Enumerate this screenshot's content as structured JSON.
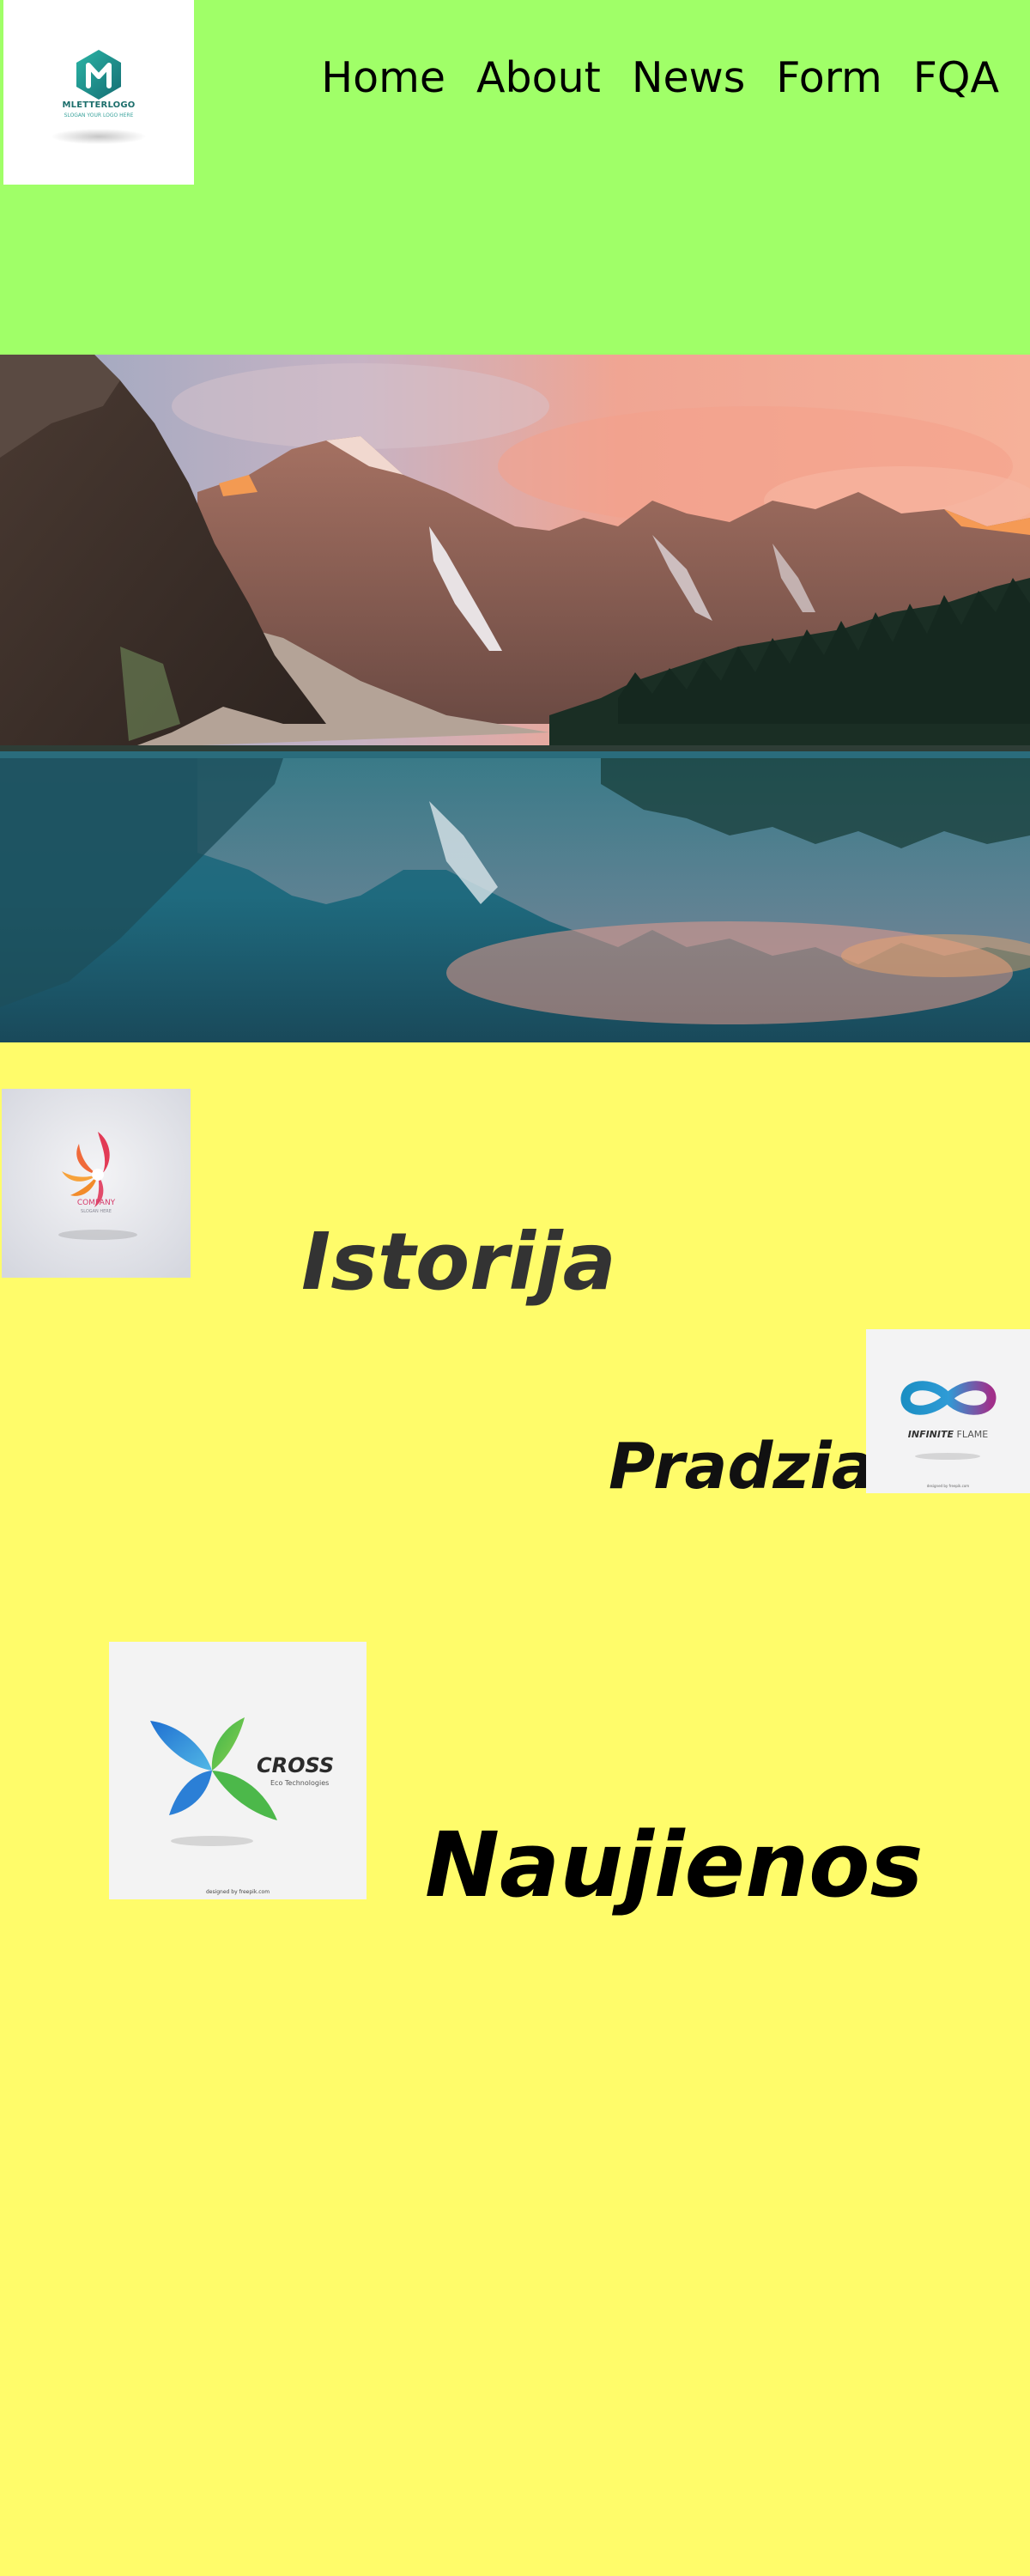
{
  "logo": {
    "title": "MLETTERLOGO",
    "subtitle": "SLOGAN YOUR LOGO HERE",
    "icon": "hexagon-m-logo-icon"
  },
  "nav": {
    "items": [
      {
        "label": "Home"
      },
      {
        "label": "About"
      },
      {
        "label": "News"
      },
      {
        "label": "Form"
      },
      {
        "label": "FQA"
      }
    ]
  },
  "hero": {
    "alt": "mountain-lake-landscape-image"
  },
  "sections": {
    "istorija": {
      "heading": "Istorija",
      "logo_text": "COMPANY",
      "logo_sub": "SLOGAN HERE",
      "icon": "flame-flower-logo-icon"
    },
    "pradzia": {
      "heading": "Pradzia",
      "logo_text_bold": "INFINITE",
      "logo_text_light": "FLAME",
      "logo_credit": "designed by freepik.com",
      "icon": "infinity-logo-icon"
    },
    "naujienos": {
      "heading": "Naujienos",
      "logo_text": "CROSS",
      "logo_sub": "Eco Technologies",
      "logo_credit": "designed by freepik.com",
      "icon": "cross-leaves-logo-icon"
    }
  },
  "colors": {
    "header_bg": "#a0ff68",
    "page_bg": "#fffc6a",
    "logo_teal": "#1d8f8a"
  }
}
